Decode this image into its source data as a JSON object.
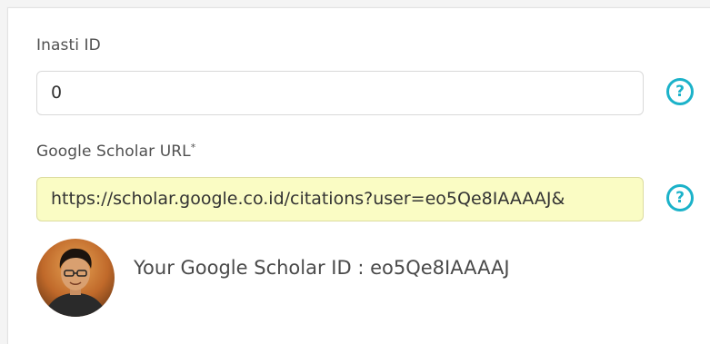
{
  "inasti": {
    "label": "Inasti ID",
    "value": "0"
  },
  "scholar": {
    "label": "Google Scholar URL",
    "required_mark": "*",
    "value": "https://scholar.google.co.id/citations?user=eo5Qe8IAAAAJ&",
    "id_text": "Your Google Scholar ID : eo5Qe8IAAAAJ"
  },
  "help_symbol": "?",
  "icons": {
    "help": "question-circle-icon",
    "avatar": "user-avatar-photo"
  },
  "colors": {
    "accent": "#1bb2c9",
    "highlight_field": "#fafcc4",
    "text": "#505050"
  }
}
